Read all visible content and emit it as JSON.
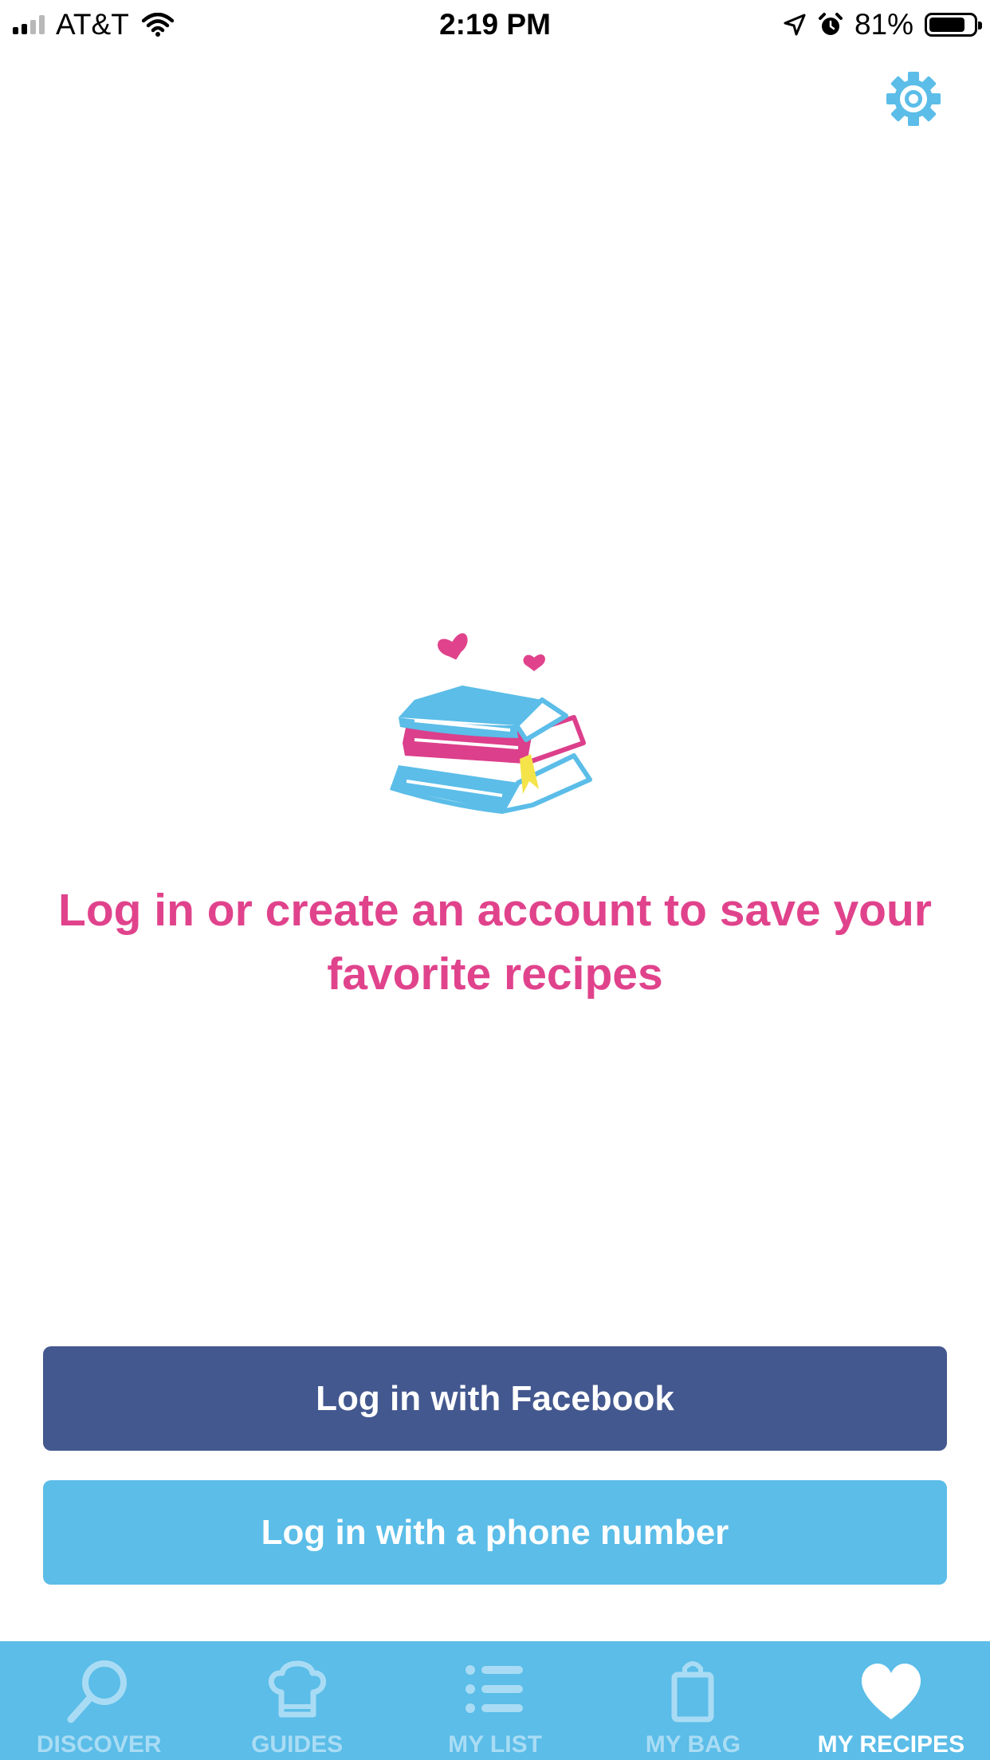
{
  "status_bar": {
    "carrier": "AT&T",
    "time": "2:19 PM",
    "battery_percent": "81%",
    "battery_level": 0.81,
    "signal_bars": 2
  },
  "header": {
    "settings_icon": "gear-icon"
  },
  "main": {
    "illustration": "book-stack-hearts-illustration",
    "message": "Log in or create an account to save your favorite recipes"
  },
  "actions": {
    "facebook_label": "Log in with Facebook",
    "phone_label": "Log in with a phone number"
  },
  "tab_bar": {
    "tabs": [
      {
        "label": "DISCOVER",
        "icon": "search-icon"
      },
      {
        "label": "GUIDES",
        "icon": "chef-hat-icon"
      },
      {
        "label": "MY LIST",
        "icon": "list-icon"
      },
      {
        "label": "MY BAG",
        "icon": "shopping-bag-icon"
      },
      {
        "label": "MY RECIPES",
        "icon": "heart-icon"
      }
    ],
    "active_index": 4
  },
  "colors": {
    "accent_pink": "#e0438c",
    "accent_blue": "#5bbde8",
    "facebook_blue": "#43588f",
    "tab_inactive": "#a9dcf4"
  }
}
